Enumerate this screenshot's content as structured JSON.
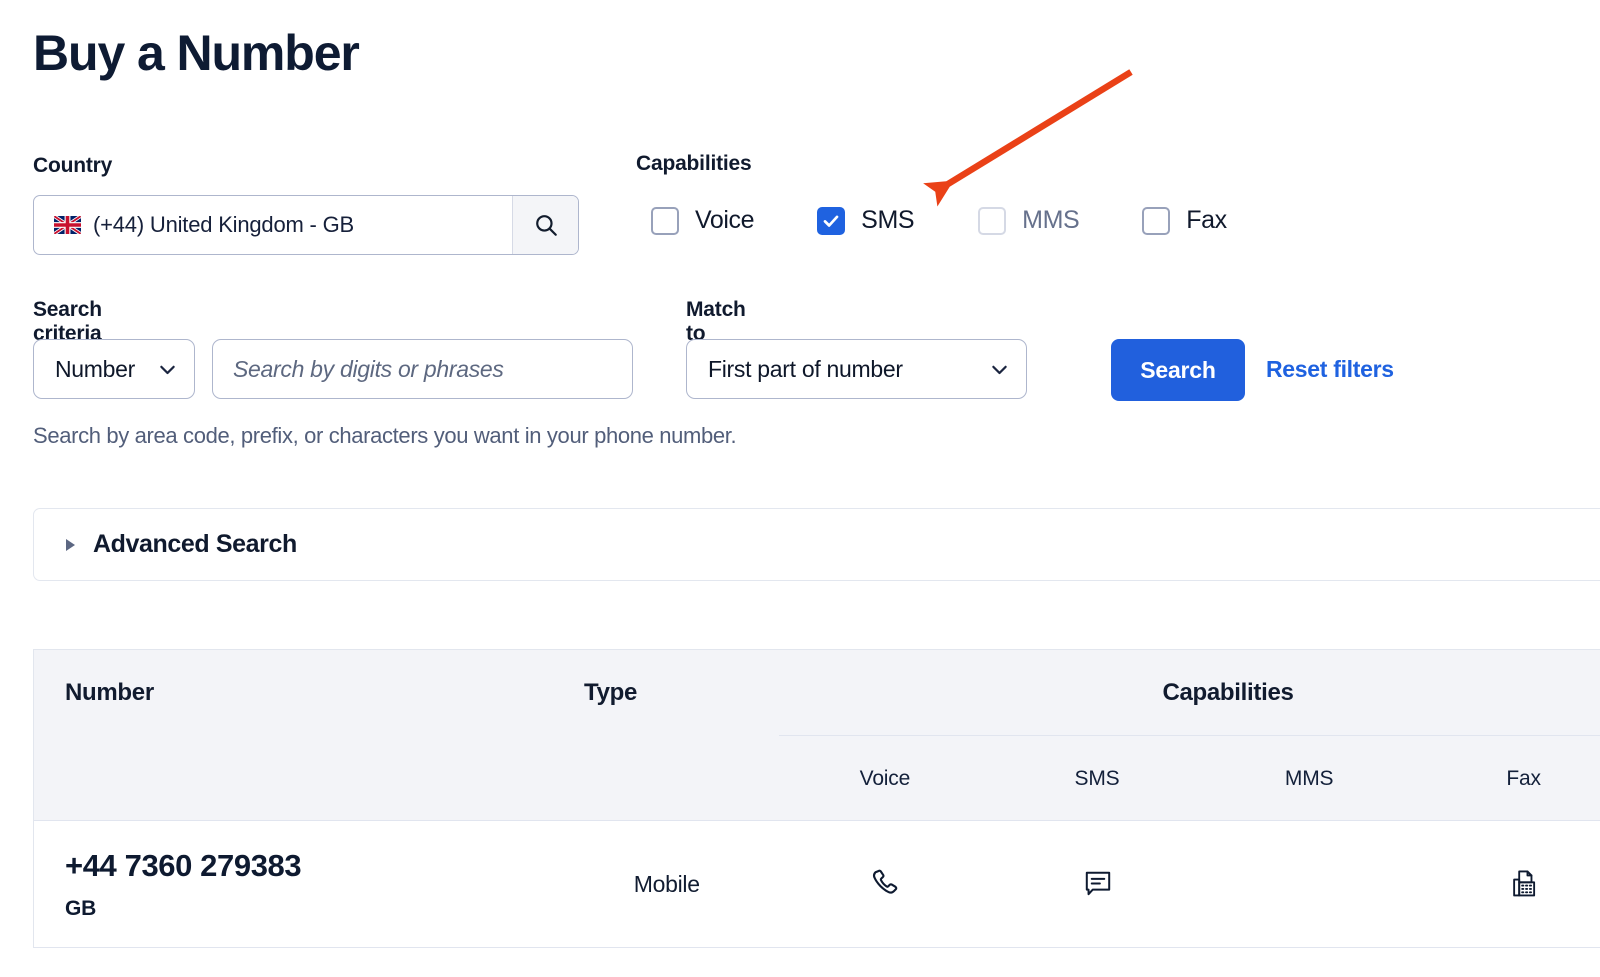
{
  "page": {
    "title": "Buy a Number"
  },
  "country": {
    "label": "Country",
    "value": "(+44) United Kingdom - GB",
    "flag_icon": "flag-gb-icon",
    "search_icon": "search-icon"
  },
  "capabilities": {
    "label": "Capabilities",
    "items": [
      {
        "label": "Voice",
        "checked": false,
        "disabled": false
      },
      {
        "label": "SMS",
        "checked": true,
        "disabled": false
      },
      {
        "label": "MMS",
        "checked": false,
        "disabled": true
      },
      {
        "label": "Fax",
        "checked": false,
        "disabled": false
      }
    ]
  },
  "search_criteria": {
    "label": "Search criteria",
    "selected": "Number",
    "input_value": "",
    "input_placeholder": "Search by digits or phrases",
    "chevron_icon": "chevron-down-icon"
  },
  "match_to": {
    "label": "Match to",
    "selected": "First part of number",
    "chevron_icon": "chevron-down-icon"
  },
  "actions": {
    "search_label": "Search",
    "reset_label": "Reset filters",
    "accent_color": "#2160dd",
    "link_color": "#1f62e0"
  },
  "helper_text": "Search by area code, prefix, or characters you want in your phone number.",
  "advanced_search": {
    "label": "Advanced Search",
    "expanded": false,
    "caret_icon": "caret-right-icon"
  },
  "results_table": {
    "headers": {
      "number": "Number",
      "type": "Type",
      "capabilities": "Capabilities"
    },
    "capability_columns": [
      "Voice",
      "SMS",
      "MMS",
      "Fax"
    ],
    "rows": [
      {
        "number": "+44 7360 279383",
        "country_code": "GB",
        "type": "Mobile",
        "capabilities": {
          "voice": "phone-icon",
          "sms": "chat-bubble-icon",
          "mms": "",
          "fax": "fax-machine-icon"
        }
      }
    ]
  },
  "annotation": {
    "arrow_color": "#ea4117",
    "points_to": "SMS"
  }
}
